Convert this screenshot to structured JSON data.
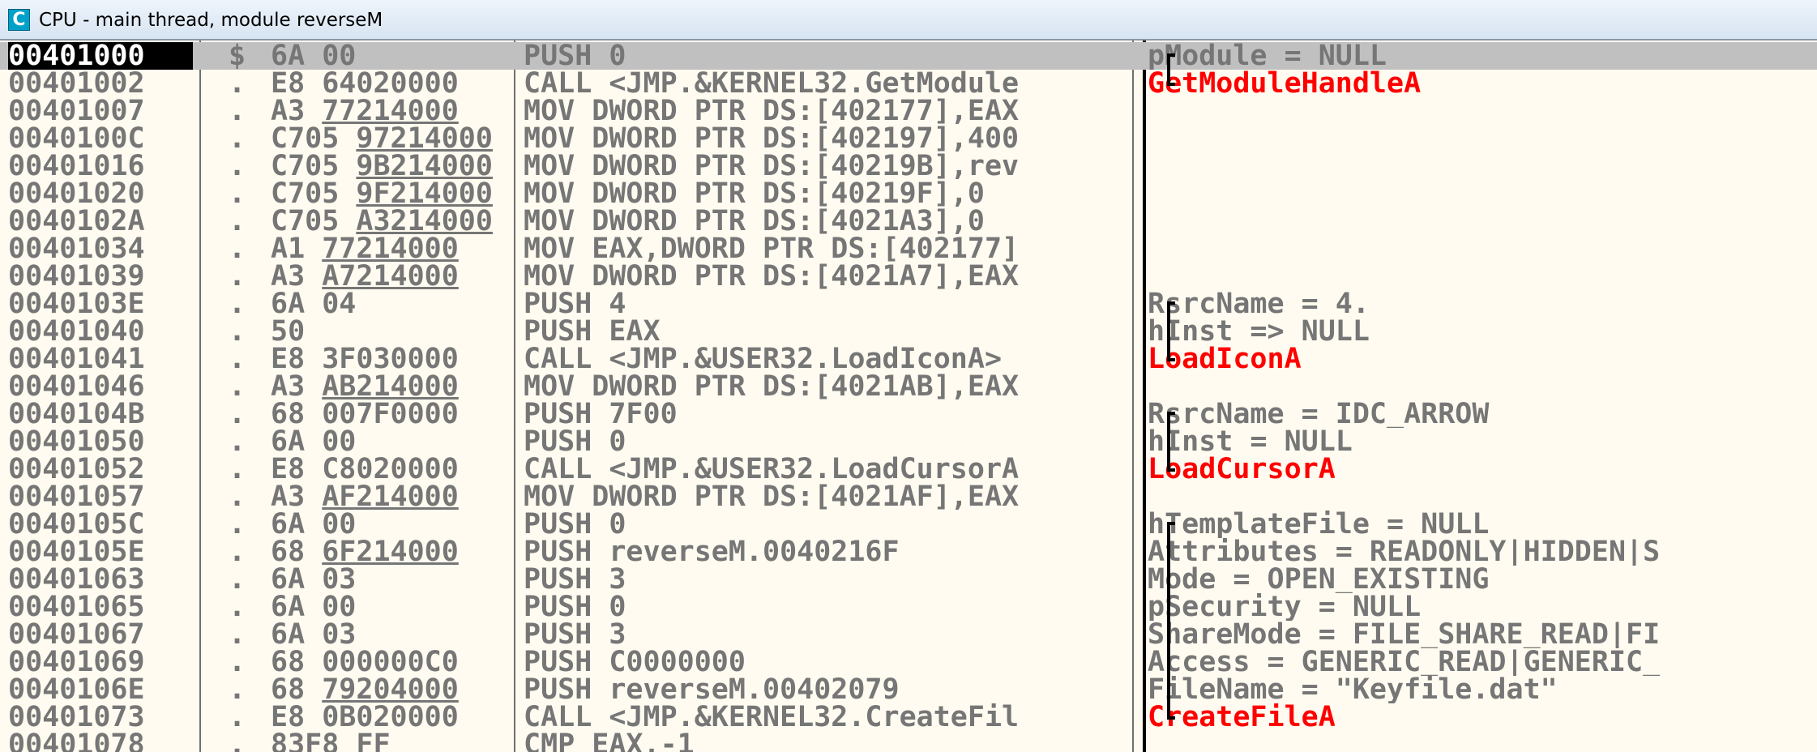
{
  "window": {
    "title": "CPU - main thread, module reverseM",
    "icon": "cpu-window-icon",
    "icon_letter": "C"
  },
  "colors": {
    "background": "#fffbf0",
    "text": "#767676",
    "api": "#ff0000",
    "selection": "#c0c0c0",
    "selected_address_bg": "#000000"
  },
  "rows": [
    {
      "address": "00401000",
      "marker": "$",
      "hex_opcode": "6A",
      "hex_operand": "00",
      "instruction": "PUSH 0",
      "comment": "pModule = NULL",
      "comment_type": "arg",
      "bracket": "top",
      "selected": true
    },
    {
      "address": "00401002",
      "marker": ".",
      "hex_opcode": "E8",
      "hex_operand": "64020000",
      "instruction": "CALL <JMP.&KERNEL32.GetModule",
      "comment": "GetModuleHandleA",
      "comment_type": "api",
      "bracket": "bot"
    },
    {
      "address": "00401007",
      "marker": ".",
      "hex_opcode": "A3",
      "hex_operand": "77214000",
      "operand_underlined": true,
      "instruction": "MOV DWORD PTR DS:[402177],EAX",
      "comment": ""
    },
    {
      "address": "0040100C",
      "marker": ".",
      "hex_opcode": "C705",
      "hex_operand": "97214000",
      "operand_underlined": true,
      "instruction": "MOV DWORD PTR DS:[402197],400",
      "comment": ""
    },
    {
      "address": "00401016",
      "marker": ".",
      "hex_opcode": "C705",
      "hex_operand": "9B214000",
      "operand_underlined": true,
      "instruction": "MOV DWORD PTR DS:[40219B],rev",
      "comment": ""
    },
    {
      "address": "00401020",
      "marker": ".",
      "hex_opcode": "C705",
      "hex_operand": "9F214000",
      "operand_underlined": true,
      "instruction": "MOV DWORD PTR DS:[40219F],0",
      "comment": ""
    },
    {
      "address": "0040102A",
      "marker": ".",
      "hex_opcode": "C705",
      "hex_operand": "A3214000",
      "operand_underlined": true,
      "instruction": "MOV DWORD PTR DS:[4021A3],0",
      "comment": ""
    },
    {
      "address": "00401034",
      "marker": ".",
      "hex_opcode": "A1",
      "hex_operand": "77214000",
      "operand_underlined": true,
      "instruction": "MOV EAX,DWORD PTR DS:[402177]",
      "comment": ""
    },
    {
      "address": "00401039",
      "marker": ".",
      "hex_opcode": "A3",
      "hex_operand": "A7214000",
      "operand_underlined": true,
      "instruction": "MOV DWORD PTR DS:[4021A7],EAX",
      "comment": ""
    },
    {
      "address": "0040103E",
      "marker": ".",
      "hex_opcode": "6A",
      "hex_operand": "04",
      "instruction": "PUSH 4",
      "comment": "RsrcName = 4.",
      "comment_type": "arg",
      "bracket": "top"
    },
    {
      "address": "00401040",
      "marker": ".",
      "hex_opcode": "50",
      "hex_operand": "",
      "instruction": "PUSH EAX",
      "comment": "hInst => NULL",
      "comment_type": "arg",
      "bracket": "mid"
    },
    {
      "address": "00401041",
      "marker": ".",
      "hex_opcode": "E8",
      "hex_operand": "3F030000",
      "instruction": "CALL <JMP.&USER32.LoadIconA>",
      "comment": "LoadIconA",
      "comment_type": "api",
      "bracket": "bot"
    },
    {
      "address": "00401046",
      "marker": ".",
      "hex_opcode": "A3",
      "hex_operand": "AB214000",
      "operand_underlined": true,
      "instruction": "MOV DWORD PTR DS:[4021AB],EAX",
      "comment": ""
    },
    {
      "address": "0040104B",
      "marker": ".",
      "hex_opcode": "68",
      "hex_operand": "007F0000",
      "instruction": "PUSH 7F00",
      "comment": "RsrcName = IDC_ARROW",
      "comment_type": "arg",
      "bracket": "top"
    },
    {
      "address": "00401050",
      "marker": ".",
      "hex_opcode": "6A",
      "hex_operand": "00",
      "instruction": "PUSH 0",
      "comment": "hInst = NULL",
      "comment_type": "arg",
      "bracket": "mid"
    },
    {
      "address": "00401052",
      "marker": ".",
      "hex_opcode": "E8",
      "hex_operand": "C8020000",
      "instruction": "CALL <JMP.&USER32.LoadCursorA",
      "comment": "LoadCursorA",
      "comment_type": "api",
      "bracket": "bot"
    },
    {
      "address": "00401057",
      "marker": ".",
      "hex_opcode": "A3",
      "hex_operand": "AF214000",
      "operand_underlined": true,
      "instruction": "MOV DWORD PTR DS:[4021AF],EAX",
      "comment": ""
    },
    {
      "address": "0040105C",
      "marker": ".",
      "hex_opcode": "6A",
      "hex_operand": "00",
      "instruction": "PUSH 0",
      "comment": "hTemplateFile = NULL",
      "comment_type": "arg",
      "bracket": "top"
    },
    {
      "address": "0040105E",
      "marker": ".",
      "hex_opcode": "68",
      "hex_operand": "6F214000",
      "operand_underlined": true,
      "instruction": "PUSH reverseM.0040216F",
      "comment": "Attributes = READONLY|HIDDEN|S",
      "comment_type": "arg",
      "bracket": "mid"
    },
    {
      "address": "00401063",
      "marker": ".",
      "hex_opcode": "6A",
      "hex_operand": "03",
      "instruction": "PUSH 3",
      "comment": "Mode = OPEN_EXISTING",
      "comment_type": "arg",
      "bracket": "mid"
    },
    {
      "address": "00401065",
      "marker": ".",
      "hex_opcode": "6A",
      "hex_operand": "00",
      "instruction": "PUSH 0",
      "comment": "pSecurity = NULL",
      "comment_type": "arg",
      "bracket": "mid"
    },
    {
      "address": "00401067",
      "marker": ".",
      "hex_opcode": "6A",
      "hex_operand": "03",
      "instruction": "PUSH 3",
      "comment": "ShareMode = FILE_SHARE_READ|FI",
      "comment_type": "arg",
      "bracket": "mid"
    },
    {
      "address": "00401069",
      "marker": ".",
      "hex_opcode": "68",
      "hex_operand": "000000C0",
      "instruction": "PUSH C0000000",
      "comment": "Access = GENERIC_READ|GENERIC_",
      "comment_type": "arg",
      "bracket": "mid"
    },
    {
      "address": "0040106E",
      "marker": ".",
      "hex_opcode": "68",
      "hex_operand": "79204000",
      "operand_underlined": true,
      "instruction": "PUSH reverseM.00402079",
      "comment": "FileName = \"Keyfile.dat\"",
      "comment_type": "arg",
      "bracket": "mid"
    },
    {
      "address": "00401073",
      "marker": ".",
      "hex_opcode": "E8",
      "hex_operand": "0B020000",
      "instruction": "CALL <JMP.&KERNEL32.CreateFil",
      "comment": "CreateFileA",
      "comment_type": "api",
      "bracket": "bot"
    },
    {
      "address": "00401078",
      "marker": ".",
      "hex_opcode": "83F8",
      "hex_operand": "FF",
      "instruction": "CMP EAX,-1",
      "comment": ""
    }
  ]
}
